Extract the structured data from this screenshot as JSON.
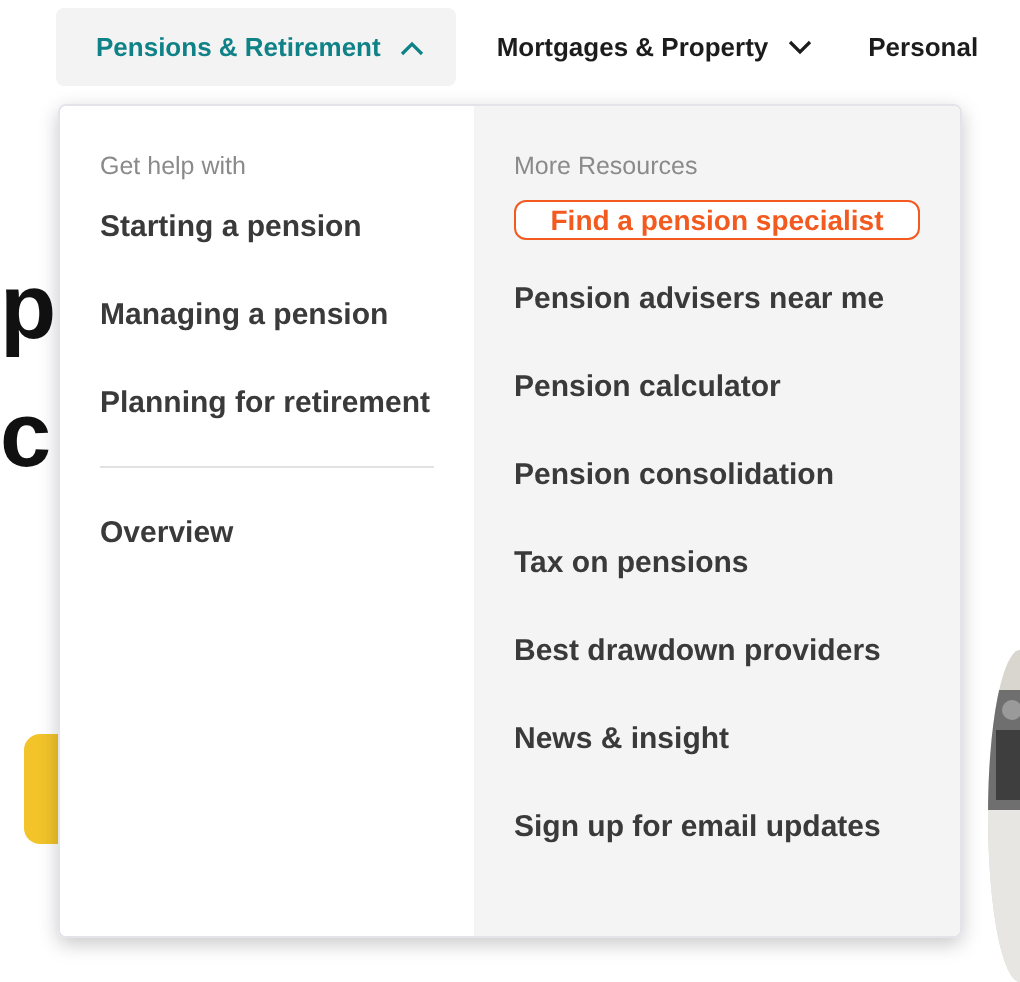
{
  "nav": [
    {
      "label": "Pensions & Retirement",
      "expanded": true,
      "selected": true
    },
    {
      "label": "Mortgages & Property",
      "expanded": false,
      "selected": false
    },
    {
      "label": "Personal",
      "selected": false
    }
  ],
  "hero": {
    "heading_lines": [
      "p",
      "c"
    ]
  },
  "dropdown": {
    "left": {
      "heading": "Get help with",
      "items": [
        "Starting a pension",
        "Managing a pension",
        "Planning for retirement"
      ],
      "footer_items": [
        "Overview"
      ]
    },
    "right": {
      "heading": "More Resources",
      "cta": "Find a pension specialist",
      "items": [
        "Pension advisers near me",
        "Pension calculator",
        "Pension consolidation",
        "Tax on pensions",
        "Best drawdown providers",
        "News & insight",
        "Sign up for email updates"
      ]
    }
  }
}
